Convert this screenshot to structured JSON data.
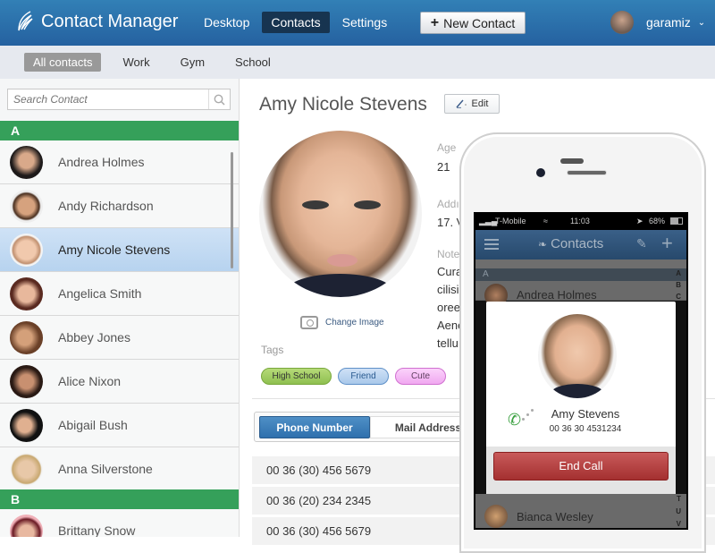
{
  "header": {
    "app_title": "Contact Manager",
    "nav": [
      {
        "label": "Desktop",
        "active": false
      },
      {
        "label": "Contacts",
        "active": true
      },
      {
        "label": "Settings",
        "active": false
      }
    ],
    "new_contact_label": "New Contact",
    "username": "garamiz"
  },
  "filters": [
    {
      "label": "All contacts",
      "active": true
    },
    {
      "label": "Work",
      "active": false
    },
    {
      "label": "Gym",
      "active": false
    },
    {
      "label": "School",
      "active": false
    }
  ],
  "sidebar": {
    "search_placeholder": "Search Contact",
    "groups": [
      {
        "letter": "A",
        "contacts": [
          "Andrea Holmes",
          "Andy Richardson",
          "Amy Nicole Stevens",
          "Angelica Smith",
          "Abbey Jones",
          "Alice Nixon",
          "Abigail Bush",
          "Anna Silverstone"
        ]
      },
      {
        "letter": "B",
        "contacts": [
          "Brittany Snow"
        ]
      }
    ],
    "selected": "Amy Nicole Stevens"
  },
  "detail": {
    "name": "Amy Nicole Stevens",
    "edit_label": "Edit",
    "change_image_label": "Change Image",
    "age_label": "Age",
    "age_value": "21",
    "address_label": "Addı",
    "address_value": "17. V",
    "notes_label": "Note",
    "notes_lines": [
      "Cura",
      "cilisi",
      "oree",
      "Aene",
      "tellu"
    ],
    "tags_label": "Tags",
    "tags": [
      {
        "label": "High School",
        "color": "#8fc050"
      },
      {
        "label": "Friend",
        "color": "#a9c8ea"
      },
      {
        "label": "Cute",
        "color": "#f0a8f0"
      }
    ],
    "tabs": [
      {
        "label": "Phone Number",
        "active": true
      },
      {
        "label": "Mail Address",
        "active": false
      }
    ],
    "phone_numbers": [
      "00 36 (30) 456 5679",
      "00 36 (20) 234 2345",
      "00 36 (30) 456 5679"
    ]
  },
  "phone": {
    "carrier": "T-Mobile",
    "time": "11:03",
    "battery": "68%",
    "title": "Contacts",
    "group_letter": "A",
    "rows": [
      "Andrea Holmes",
      "Bianca Wesley"
    ],
    "index_top": [
      "A",
      "B",
      "C"
    ],
    "index_bottom": [
      "T",
      "U",
      "V"
    ],
    "call": {
      "name": "Amy Stevens",
      "number": "00 36 30 4531234",
      "end_call_label": "End Call"
    }
  },
  "colors": {
    "header_blue": "#2a6aa8",
    "group_green": "#35a05a",
    "selected_row": "#c5dcf3",
    "end_call_red": "#b84444"
  }
}
